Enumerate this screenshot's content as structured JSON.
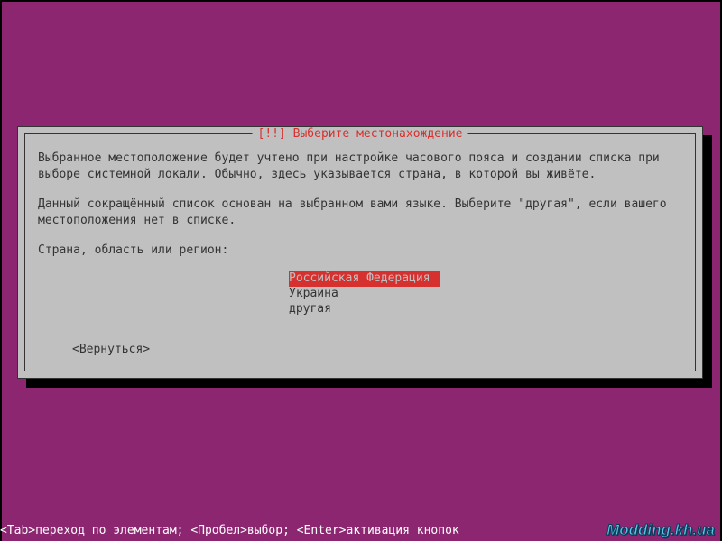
{
  "dialog": {
    "title_prefix": "[!!]",
    "title": "Выберите местонахождение",
    "paragraph1": "Выбранное местоположение будет учтено при настройке часового пояса и создании списка при выборе системной локали. Обычно, здесь указывается страна, в которой вы живёте.",
    "paragraph2": "Данный сокращённый список основан на выбранном вами языке. Выберите \"другая\", если вашего местоположения нет в списке.",
    "prompt": "Страна, область или регион:",
    "options": [
      {
        "label": "Российская Федерация",
        "selected": true
      },
      {
        "label": "Украина",
        "selected": false
      },
      {
        "label": "другая",
        "selected": false
      }
    ],
    "back_label": "<Вернуться>"
  },
  "footer": {
    "hints": "<Tab>переход по элементам; <Пробел>выбор; <Enter>активация кнопок"
  },
  "watermark": "Modding.kh.ua"
}
